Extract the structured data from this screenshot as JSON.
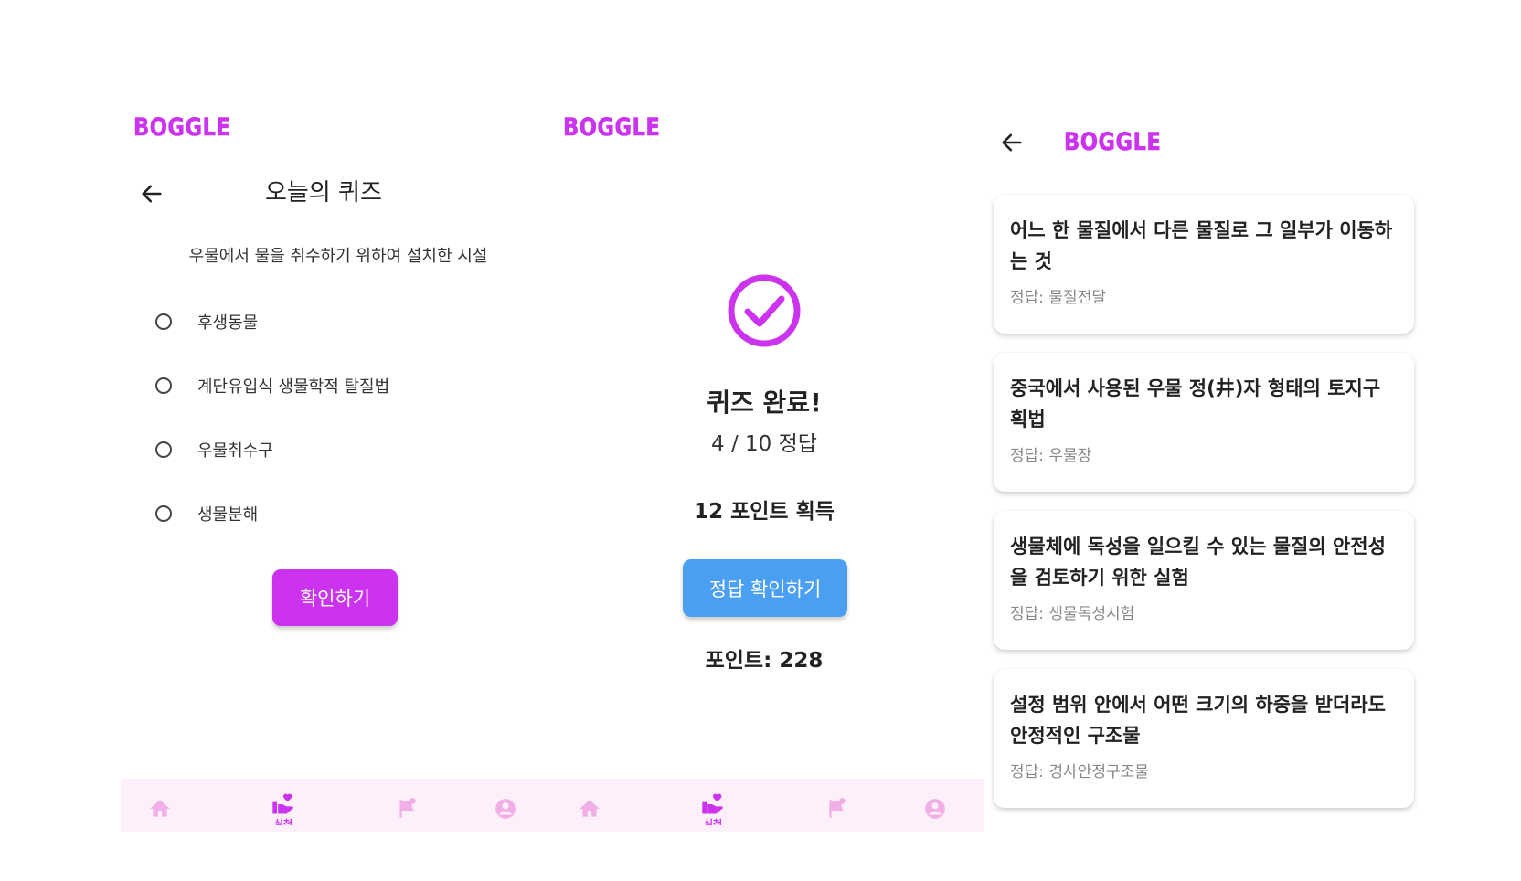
{
  "app": {
    "logo": "BOGGLE"
  },
  "quiz_screen": {
    "title": "오늘의 퀴즈",
    "question": "우물에서 물을 취수하기 위하여 설치한 시설",
    "options": [
      "후생동물",
      "계단유입식 생물학적 탈질법",
      "우물취수구",
      "생물분해"
    ],
    "confirm_label": "확인하기"
  },
  "result_screen": {
    "complete_title": "퀴즈 완료!",
    "score": "4 / 10 정답",
    "points_earned": "12 포인트 획득",
    "view_answers_label": "정답 확인하기",
    "total_points": "포인트: 228"
  },
  "nav": {
    "items": [
      {
        "icon": "home-icon"
      },
      {
        "icon": "practice-icon",
        "label": "실천"
      },
      {
        "icon": "flag-icon"
      },
      {
        "icon": "profile-icon"
      }
    ],
    "active_color": "#cc33ee",
    "inactive_color": "#f2aee6"
  },
  "answers_screen": {
    "cards": [
      {
        "question": "어느 한 물질에서 다른 물질로 그 일부가 이동하는 것",
        "answer": "정답: 물질전달"
      },
      {
        "question": "중국에서 사용된 우물 정(井)자 형태의 토지구획법",
        "answer": "정답: 우물장"
      },
      {
        "question": "생물체에 독성을 일으킬 수 있는 물질의 안전성을 검토하기 위한 실험",
        "answer": "정답: 생물독성시험"
      },
      {
        "question": "설정 범위 안에서 어떤 크기의 하중을 받더라도 안정적인 구조물",
        "answer": "정답: 경사안정구조물"
      }
    ]
  },
  "colors": {
    "brand": "#cc33ee",
    "primary_button": "#cc33ee",
    "secondary_button": "#4a9ff2",
    "nav_background": "#fdf0fb"
  }
}
